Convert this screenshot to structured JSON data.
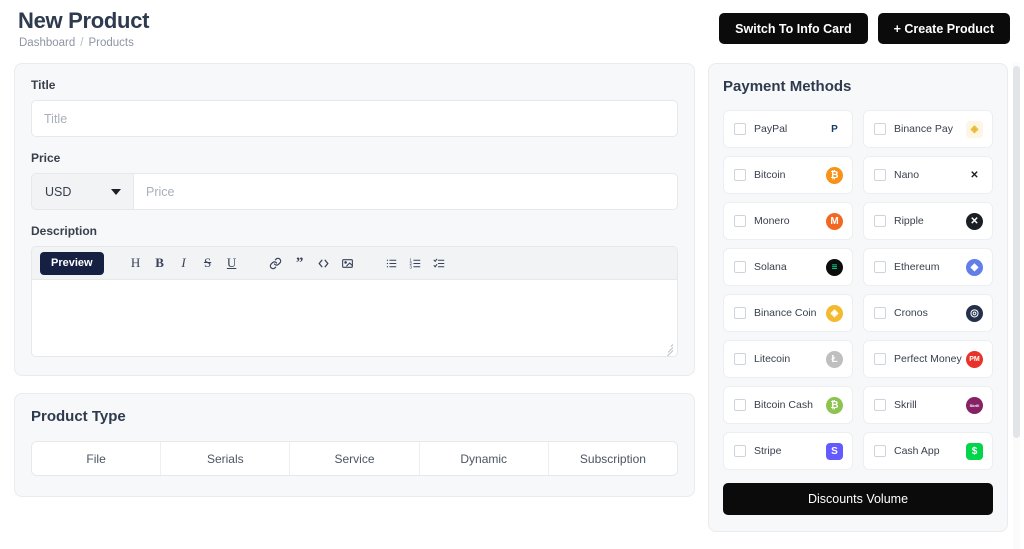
{
  "header": {
    "title": "New Product",
    "breadcrumb": {
      "root": "Dashboard",
      "separator": "/",
      "current": "Products"
    },
    "buttons": {
      "switch_info_card": "Switch To Info Card",
      "create_product": "+ Create Product"
    }
  },
  "details": {
    "title_label": "Title",
    "title_placeholder": "Title",
    "title_value": "",
    "price_label": "Price",
    "currency_value": "USD",
    "price_placeholder": "Price",
    "price_value": "",
    "description_label": "Description",
    "description_value": "",
    "toolbar": {
      "preview_label": "Preview",
      "heading": "H",
      "bold": "B",
      "italic": "I",
      "strikethrough": "S",
      "underline": "U"
    }
  },
  "product_type": {
    "title": "Product Type",
    "tabs": [
      "File",
      "Serials",
      "Service",
      "Dynamic",
      "Subscription"
    ]
  },
  "payment_methods": {
    "title": "Payment Methods",
    "discount_button": "Discounts Volume",
    "items": [
      {
        "label": "PayPal",
        "icon": "paypal-icon",
        "glyph": "P",
        "bg": "#ffffff",
        "fg": "#1a3a6b",
        "shape": "plain"
      },
      {
        "label": "Binance Pay",
        "icon": "binance-pay-icon",
        "glyph": "◈",
        "bg": "#fdf6e3",
        "fg": "#e8b931",
        "shape": "sq"
      },
      {
        "label": "Bitcoin",
        "icon": "bitcoin-icon",
        "glyph": "₿",
        "bg": "#f7931a",
        "fg": "#ffffff",
        "shape": "circle"
      },
      {
        "label": "Nano",
        "icon": "nano-icon",
        "glyph": "✕",
        "bg": "#ffffff",
        "fg": "#1b1f25",
        "shape": "plain"
      },
      {
        "label": "Monero",
        "icon": "monero-icon",
        "glyph": "M",
        "bg": "#f26822",
        "fg": "#ffffff",
        "shape": "circle"
      },
      {
        "label": "Ripple",
        "icon": "ripple-icon",
        "glyph": "✕",
        "bg": "#1b1f25",
        "fg": "#ffffff",
        "shape": "circle"
      },
      {
        "label": "Solana",
        "icon": "solana-icon",
        "glyph": "≡",
        "bg": "#0d0d0d",
        "fg": "#00ffa3",
        "shape": "circle"
      },
      {
        "label": "Ethereum",
        "icon": "ethereum-icon",
        "glyph": "◆",
        "bg": "#627eea",
        "fg": "#ffffff",
        "shape": "circle"
      },
      {
        "label": "Binance Coin",
        "icon": "binance-coin-icon",
        "glyph": "◈",
        "bg": "#f3ba2f",
        "fg": "#ffffff",
        "shape": "circle"
      },
      {
        "label": "Cronos",
        "icon": "cronos-icon",
        "glyph": "◎",
        "bg": "#25314c",
        "fg": "#ffffff",
        "shape": "circle"
      },
      {
        "label": "Litecoin",
        "icon": "litecoin-icon",
        "glyph": "Ł",
        "bg": "#bfbfbf",
        "fg": "#ffffff",
        "shape": "circle"
      },
      {
        "label": "Perfect Money",
        "icon": "perfect-money-icon",
        "glyph": "PM",
        "bg": "#e8332a",
        "fg": "#ffffff",
        "shape": "circle"
      },
      {
        "label": "Bitcoin Cash",
        "icon": "bitcoin-cash-icon",
        "glyph": "₿",
        "bg": "#8dc351",
        "fg": "#ffffff",
        "shape": "circle"
      },
      {
        "label": "Skrill",
        "icon": "skrill-icon",
        "glyph": "Skrill",
        "bg": "#862165",
        "fg": "#ffffff",
        "shape": "circle"
      },
      {
        "label": "Stripe",
        "icon": "stripe-icon",
        "glyph": "S",
        "bg": "#635bff",
        "fg": "#ffffff",
        "shape": "sq"
      },
      {
        "label": "Cash App",
        "icon": "cash-app-icon",
        "glyph": "$",
        "bg": "#00d54b",
        "fg": "#ffffff",
        "shape": "sq"
      }
    ]
  }
}
